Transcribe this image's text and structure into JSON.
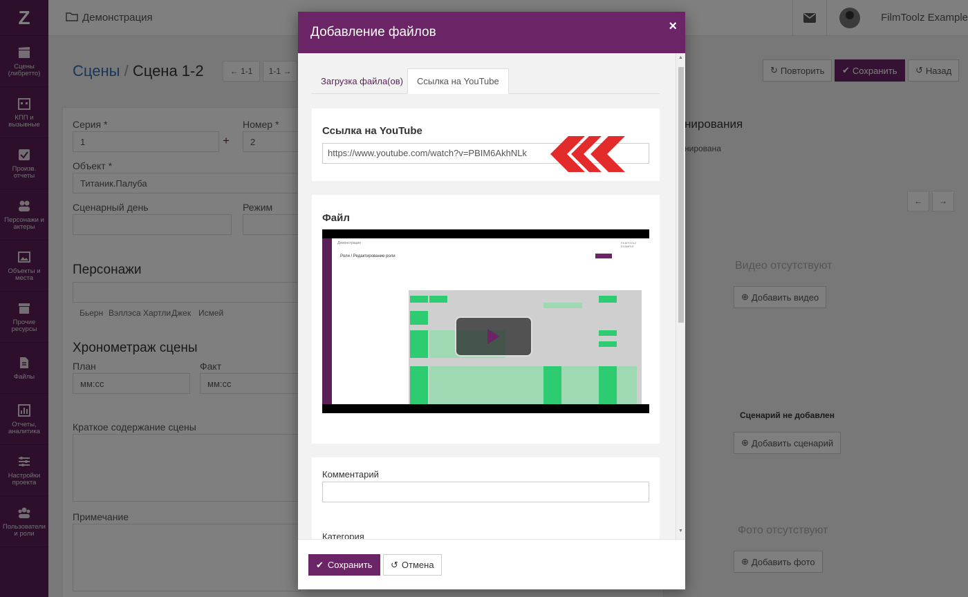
{
  "sidebar": {
    "logo": "Z",
    "items": [
      {
        "label": "Сцены (либретто)",
        "icon": "clapperboard-icon"
      },
      {
        "label": "КПП и вызывные",
        "icon": "calendar-icon"
      },
      {
        "label": "Произв. отчеты",
        "icon": "checkbox-icon"
      },
      {
        "label": "Персонажи и актеры",
        "icon": "people-icon"
      },
      {
        "label": "Объекты и места",
        "icon": "image-icon"
      },
      {
        "label": "Прочие ресурсы",
        "icon": "box-icon"
      },
      {
        "label": "Файлы",
        "icon": "file-icon"
      },
      {
        "label": "Отчеты, аналитика",
        "icon": "bar-chart-icon"
      },
      {
        "label": "Настройки проекта",
        "icon": "sliders-icon"
      },
      {
        "label": "Пользователи и роли",
        "icon": "users-icon"
      }
    ]
  },
  "topbar": {
    "breadcrumb": "Демонстрация",
    "user": "FilmToolz Example"
  },
  "page": {
    "title_link": "Сцены",
    "title_sep": "/",
    "title_current": "Сцена 1-2",
    "prev_label": "1-1",
    "next_label": "1-1",
    "repeat_label": "Повторить",
    "save_label": "Сохранить",
    "back_label": "Назад",
    "series_label": "Серия",
    "series_value": "1",
    "number_label": "Номер",
    "number_value": "2",
    "object_label": "Объект",
    "object_value": "Титаник.Палуба",
    "day_label": "Сценарный день",
    "mode_label": "Режим",
    "characters_heading": "Персонажи",
    "characters": [
      "Бьерн",
      "Вэллэса Хартли",
      "Джек",
      "Исмей"
    ],
    "timing_heading": "Хронометраж сцены",
    "plan_label": "План",
    "fact_label": "Факт",
    "time_placeholder": "мм:сс",
    "summary_label": "Краткое содержание сцены",
    "note_label": "Примечание",
    "planning_heading": "нирования",
    "planning_status": "нирована",
    "no_video": "Видео отсутствуют",
    "add_video": "Добавить видео",
    "no_script": "Сценарий не добавлен",
    "add_script": "Добавить сценарий",
    "no_photo": "Фото отсутствуют",
    "add_photo": "Добавить фото"
  },
  "modal": {
    "title": "Добавление файлов",
    "close": "×",
    "tabs": [
      {
        "label": "Загрузка файла(ов)",
        "active": false
      },
      {
        "label": "Ссылка на YouTube",
        "active": true
      }
    ],
    "youtube_heading": "Ссылка на YouTube",
    "youtube_value": "https://www.youtube.com/watch?v=PBIM6AkhNLk",
    "file_heading": "Файл",
    "comment_label": "Комментарий",
    "category_label": "Категория",
    "save_label": "Сохранить",
    "cancel_label": "Отмена"
  },
  "video_preview": {
    "crumb": "Демонстрация",
    "title": "Роли / Редактирование роли",
    "user": "FILMTOOLZ EXAMPLE"
  },
  "colors": {
    "brand": "#6b2466",
    "sidebar": "#5a1f56",
    "link": "#2c6fb7",
    "arrow": "#e32b2b",
    "cell_green": "#2ecc71"
  }
}
